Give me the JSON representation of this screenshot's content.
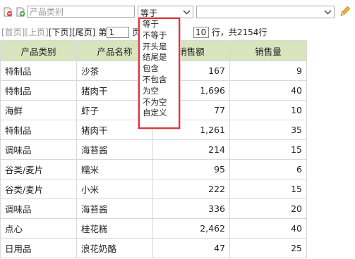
{
  "filter": {
    "field_placeholder": "产品类别",
    "operator_selected": "等于",
    "value_text": ""
  },
  "pager": {
    "first": "[首页]",
    "prev": "[上页]",
    "next": "[下页]",
    "last": "[尾页]",
    "page_prefix": "第",
    "page_value": "1",
    "page_suffix": "页",
    "rows_value": "10",
    "rows_suffix": "行，共2154行"
  },
  "table": {
    "columns": [
      "产品类别",
      "产品名称",
      "销售额",
      "销售量"
    ],
    "rows": [
      [
        "特制品",
        "沙茶",
        "167",
        "9"
      ],
      [
        "特制品",
        "猪肉干",
        "1,696",
        "40"
      ],
      [
        "海鲜",
        "虾子",
        "77",
        "10"
      ],
      [
        "特制品",
        "猪肉干",
        "1,261",
        "35"
      ],
      [
        "调味品",
        "海苔酱",
        "214",
        "15"
      ],
      [
        "谷类/麦片",
        "糯米",
        "95",
        "6"
      ],
      [
        "谷类/麦片",
        "小米",
        "222",
        "15"
      ],
      [
        "调味品",
        "海苔酱",
        "336",
        "20"
      ],
      [
        "点心",
        "桂花糕",
        "2,462",
        "40"
      ],
      [
        "日用品",
        "浪花奶酪",
        "47",
        "25"
      ]
    ]
  },
  "operator_options": [
    "等于",
    "不等于",
    "开头是",
    "结尾是",
    "包含",
    "不包含",
    "为空",
    "不为空",
    "自定义"
  ],
  "icons": [
    "remove-filter-icon",
    "add-filter-icon",
    "chevron-down-icon",
    "edit-pencil-icon"
  ],
  "colors": {
    "header_bg": "#d7e4bd",
    "dropdown_border": "#d9363e",
    "disabled_text": "#9a9a9a"
  }
}
